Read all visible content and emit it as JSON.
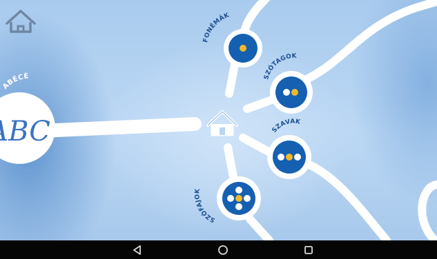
{
  "nodes": {
    "abece": {
      "label": "ABÉCÉ",
      "logo_text": "ABC"
    },
    "fonemak": {
      "label": "FONÉMÁK"
    },
    "szotagok": {
      "label": "SZÓTAGOK"
    },
    "szavak": {
      "label": "SZAVAK"
    },
    "szofajok": {
      "label": "SZÓFAJOK"
    }
  },
  "icons": {
    "top_left": "home-icon",
    "center": "home-icon",
    "nav": [
      "back-triangle-icon",
      "home-circle-icon",
      "recents-square-icon"
    ]
  },
  "colors": {
    "badge_blue": "#1560b0",
    "dot_yellow": "#f2b82a",
    "dot_white": "#ffffff",
    "path_white": "#ffffff",
    "label_blue": "#1d4f8f"
  }
}
